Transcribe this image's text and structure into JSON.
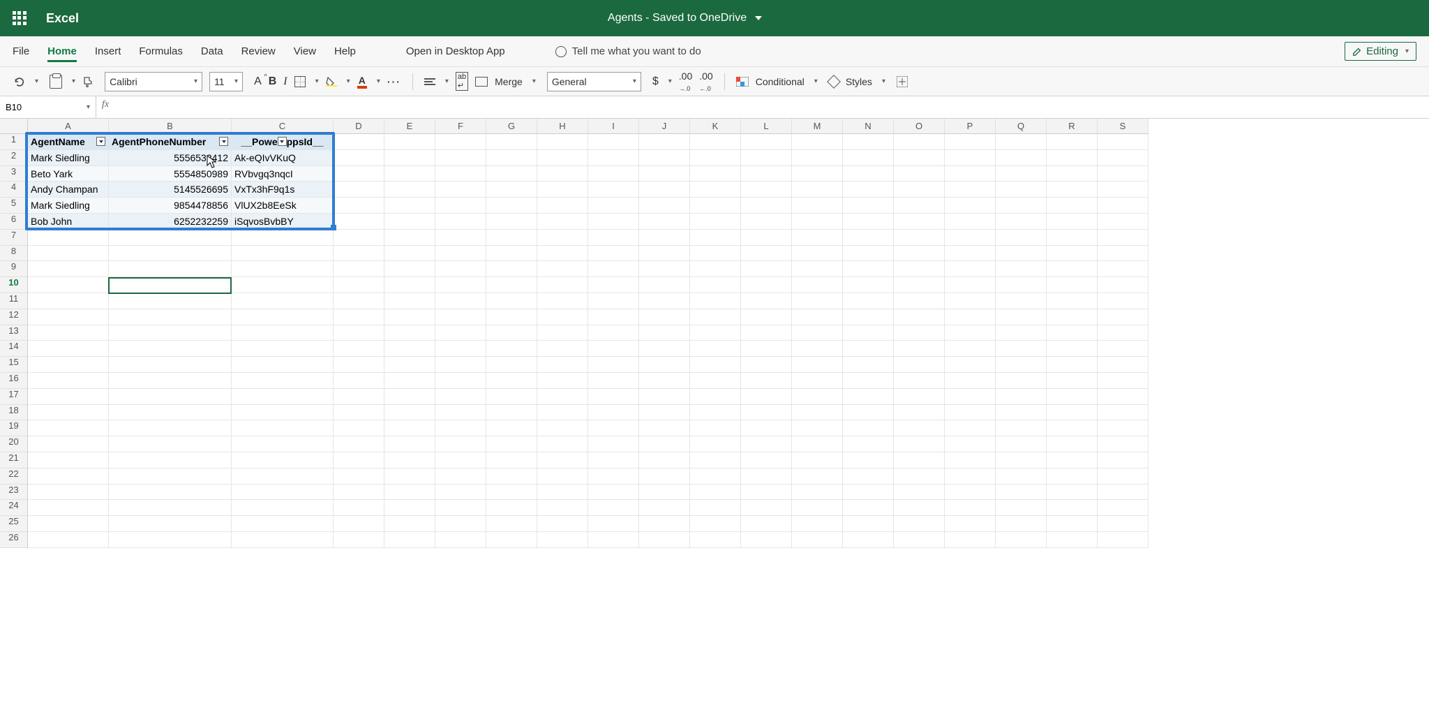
{
  "titlebar": {
    "app": "Excel",
    "doc_title": "Agents - Saved to OneDrive"
  },
  "menubar": {
    "file": "File",
    "home": "Home",
    "insert": "Insert",
    "formulas": "Formulas",
    "data": "Data",
    "review": "Review",
    "view": "View",
    "help": "Help",
    "open_desktop": "Open in Desktop App",
    "tell_me": "Tell me what you want to do",
    "editing": "Editing"
  },
  "toolbar": {
    "font": "Calibri",
    "font_size": "11",
    "merge": "Merge",
    "num_format": "General",
    "conditional": "Conditional",
    "styles": "Styles"
  },
  "namebox": {
    "cell_ref": "B10",
    "formula": ""
  },
  "columns": [
    "A",
    "B",
    "C",
    "D",
    "E",
    "F",
    "G",
    "H",
    "I",
    "J",
    "K",
    "L",
    "M",
    "N",
    "O",
    "P",
    "Q",
    "R",
    "S"
  ],
  "row_numbers": [
    1,
    2,
    3,
    4,
    5,
    6,
    7,
    8,
    9,
    10,
    11,
    12,
    13,
    14,
    15,
    16,
    17,
    18,
    19,
    20,
    21,
    22,
    23,
    24,
    25,
    26
  ],
  "table": {
    "headers": {
      "col_a": "AgentName",
      "col_b": "AgentPhoneNumber",
      "col_c_left": "__Powe",
      "col_c_right": "ppsId__"
    },
    "rows": [
      {
        "name": "Mark Siedling",
        "phone": "5556532412",
        "pid": "Ak-eQIvVKuQ"
      },
      {
        "name": "Beto Yark",
        "phone": "5554850989",
        "pid": "RVbvgq3nqcI"
      },
      {
        "name": "Andy Champan",
        "phone": "5145526695",
        "pid": "VxTx3hF9q1s"
      },
      {
        "name": "Mark Siedling",
        "phone": "9854478856",
        "pid": "VlUX2b8EeSk"
      },
      {
        "name": "Bob John",
        "phone": "6252232259",
        "pid": "iSqvosBvbBY"
      }
    ]
  }
}
